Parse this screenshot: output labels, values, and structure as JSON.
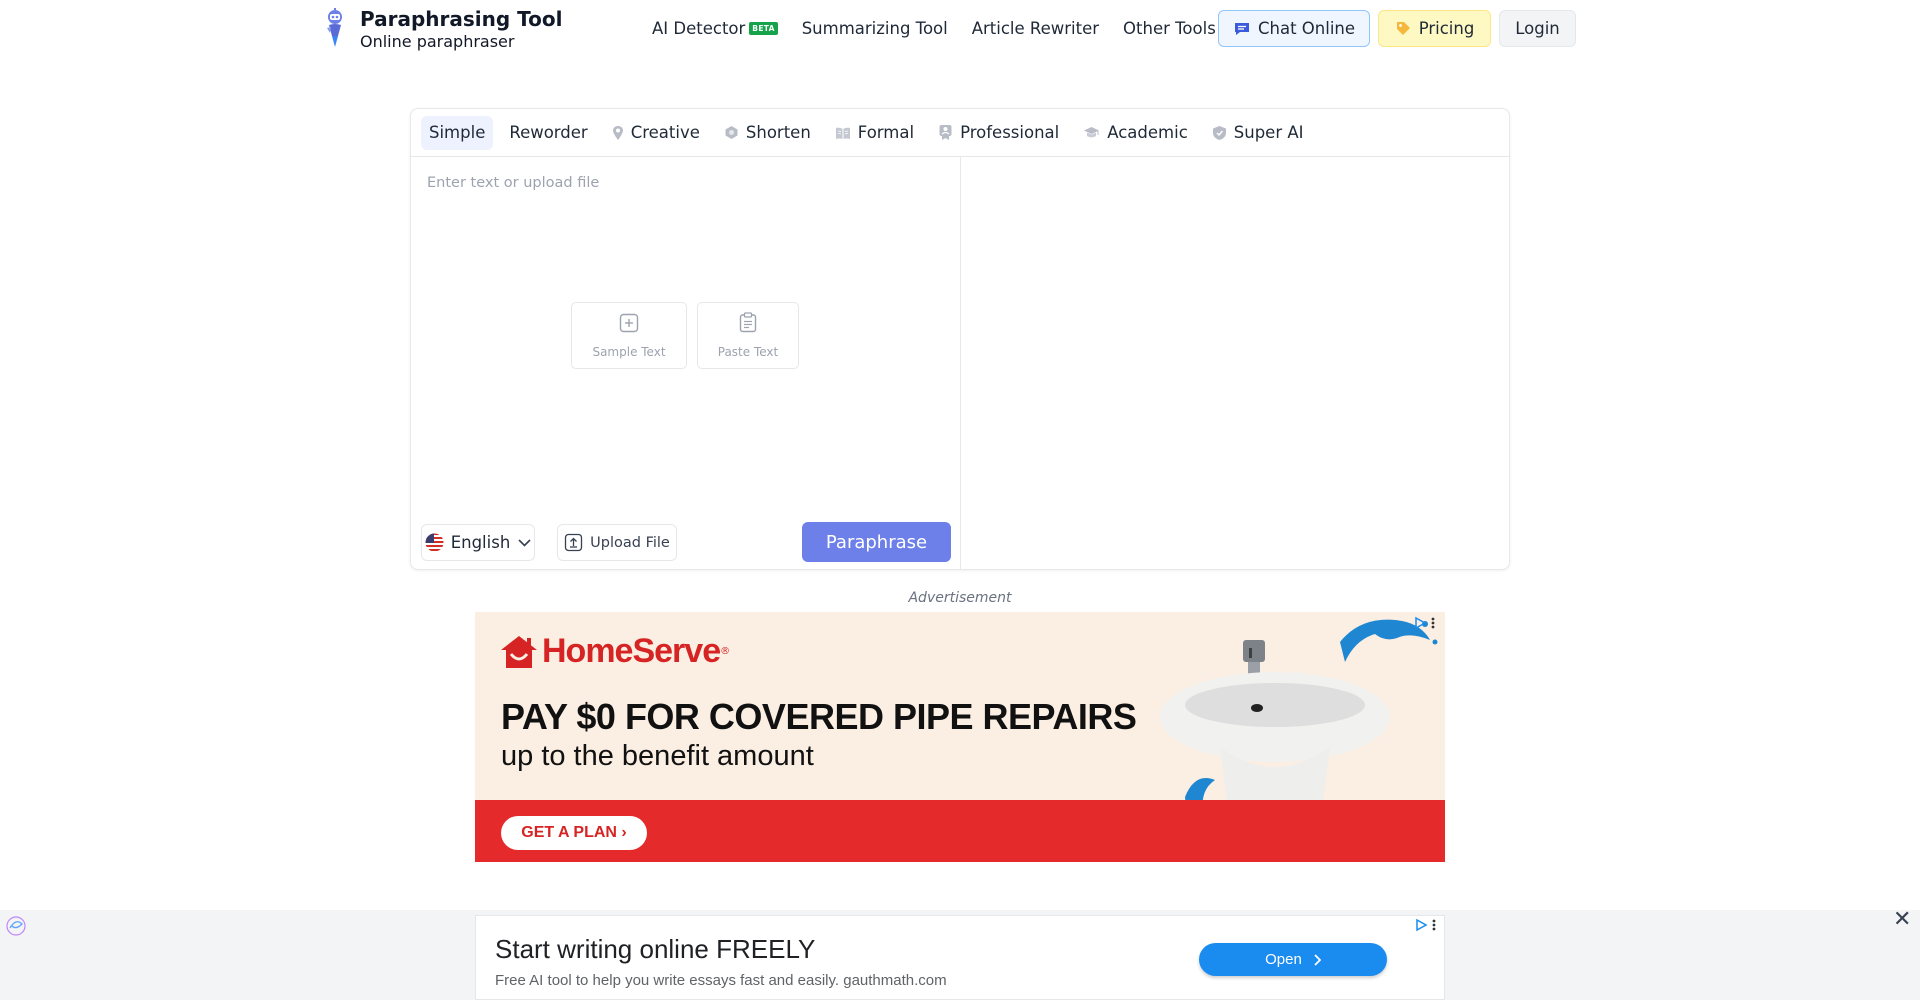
{
  "header": {
    "brand_title": "Paraphrasing Tool",
    "brand_subtitle": "Online paraphraser",
    "nav": {
      "ai_detector": "AI Detector",
      "beta": "BETA",
      "summarizing": "Summarizing Tool",
      "article_rewriter": "Article Rewriter",
      "other_tools": "Other Tools"
    },
    "chat_label": "Chat Online",
    "pricing_label": "Pricing",
    "login_label": "Login"
  },
  "editor": {
    "modes": [
      {
        "label": "Simple",
        "icon": "none",
        "active": true
      },
      {
        "label": "Reworder",
        "icon": "none",
        "active": false
      },
      {
        "label": "Creative",
        "icon": "pin-icon",
        "active": false
      },
      {
        "label": "Shorten",
        "icon": "hexagon-icon",
        "active": false
      },
      {
        "label": "Formal",
        "icon": "book-icon",
        "active": false
      },
      {
        "label": "Professional",
        "icon": "badge-icon",
        "active": false
      },
      {
        "label": "Academic",
        "icon": "graduation-cap-icon",
        "active": false
      },
      {
        "label": "Super AI",
        "icon": "shield-icon",
        "active": false
      }
    ],
    "input_placeholder": "Enter text or upload file",
    "input_value": "",
    "sample_text_label": "Sample Text",
    "paste_text_label": "Paste Text",
    "language": "English",
    "upload_label": "Upload File",
    "paraphrase_label": "Paraphrase"
  },
  "ad_label": "Advertisement",
  "ad_banner": {
    "brand": "HomeServe",
    "brand_reg": "®",
    "headline": "PAY $0 FOR COVERED PIPE REPAIRS",
    "subline": "up to the benefit amount",
    "cta": "GET A PLAN ›",
    "colors": {
      "background": "#fbeee2",
      "band": "#e42a2a",
      "brand": "#d62424"
    }
  },
  "sticky_ad": {
    "title": "Start writing online FREELY",
    "description": "Free AI tool to help you write essays fast and easily. gauthmath.com",
    "open_label": "Open",
    "close_glyph": "✕"
  },
  "colors": {
    "primary_button": "#6d7fe8",
    "chat_bg": "#eff6ff",
    "pricing_bg": "#fef9c3",
    "beta_badge": "#16a34a",
    "open_button": "#1a8cf0"
  }
}
